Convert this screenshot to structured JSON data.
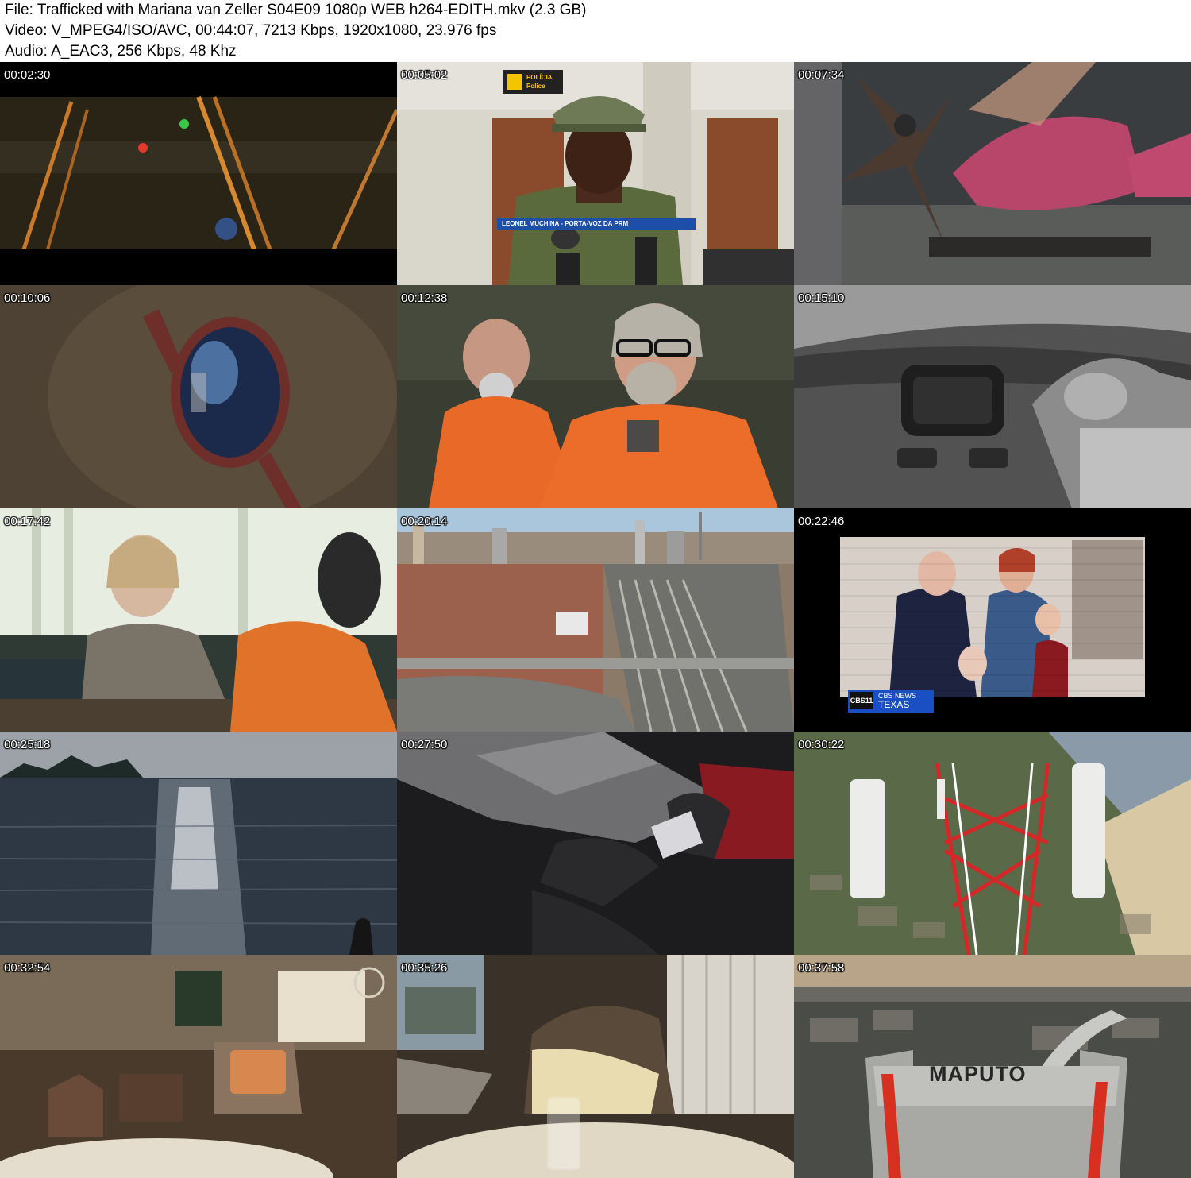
{
  "header": {
    "file_line": "File: Trafficked with Mariana van Zeller S04E09 1080p WEB h264-EDITH.mkv (2.3 GB)",
    "video_line": "Video: V_MPEG4/ISO/AVC, 00:44:07, 7213 Kbps, 1920x1080, 23.976 fps",
    "audio_line": "Audio: A_EAC3, 256 Kbps, 48 Khz"
  },
  "thumbnails": [
    {
      "timestamp": "00:02:30",
      "scene": "studio-lights"
    },
    {
      "timestamp": "00:05:02",
      "scene": "police-interview",
      "lower_third": "LEONEL MUCHINA - PORTA-VOZ DA PRM",
      "sign_line1": "POLÍCIA",
      "sign_line2": "Police"
    },
    {
      "timestamp": "00:07:34",
      "scene": "pedal-close-up"
    },
    {
      "timestamp": "00:10:06",
      "scene": "sunglasses-reflection"
    },
    {
      "timestamp": "00:12:38",
      "scene": "prisoners-orange"
    },
    {
      "timestamp": "00:15:10",
      "scene": "car-dashboard-bw"
    },
    {
      "timestamp": "00:17:42",
      "scene": "woman-interview"
    },
    {
      "timestamp": "00:20:14",
      "scene": "city-aerial-railway"
    },
    {
      "timestamp": "00:22:46",
      "scene": "family-photo-news",
      "news_channel": "CBS11",
      "news_line1": "CBS NEWS",
      "news_line2": "TEXAS"
    },
    {
      "timestamp": "00:25:18",
      "scene": "ocean-sunset"
    },
    {
      "timestamp": "00:27:50",
      "scene": "gloved-hands-foil"
    },
    {
      "timestamp": "00:30:22",
      "scene": "cell-tower-aerial"
    },
    {
      "timestamp": "00:32:54",
      "scene": "hotel-lobby"
    },
    {
      "timestamp": "00:35:26",
      "scene": "hidden-camera-room"
    },
    {
      "timestamp": "00:37:58",
      "scene": "maputo-building-aerial",
      "sign_text": "MAPUTO"
    }
  ]
}
